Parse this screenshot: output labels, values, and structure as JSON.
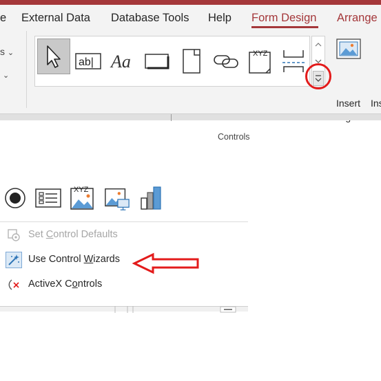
{
  "tabs": {
    "partial": "e",
    "external_data": "External Data",
    "database_tools": "Database Tools",
    "help": "Help",
    "form_design": "Form Design",
    "arrange": "Arrange"
  },
  "ribbon": {
    "left_text_1": "s",
    "left_chevron": "⌄",
    "group_label": "Controls",
    "gallery": [
      {
        "name": "select-tool-icon"
      },
      {
        "name": "text-box-icon",
        "text": "ab|"
      },
      {
        "name": "label-icon",
        "text": "Aa"
      },
      {
        "name": "button-icon"
      },
      {
        "name": "tab-control-icon"
      },
      {
        "name": "hyperlink-icon"
      },
      {
        "name": "web-browser-icon",
        "text": "XYZ"
      },
      {
        "name": "navigation-control-icon"
      }
    ],
    "insert_image": {
      "line1": "Insert",
      "line2": "Image",
      "cut": "Ins"
    }
  },
  "dropdown": {
    "icons": [
      {
        "name": "option-button-icon"
      },
      {
        "name": "list-box-icon"
      },
      {
        "name": "bound-object-frame-icon",
        "text": "XYZ"
      },
      {
        "name": "image-control-icon"
      },
      {
        "name": "chart-icon"
      }
    ],
    "items": [
      {
        "label_pre": "Set ",
        "label_key": "C",
        "label_post": "ontrol Defaults",
        "disabled": true
      },
      {
        "label_pre": "Use Control ",
        "label_key": "W",
        "label_post": "izards",
        "disabled": false
      },
      {
        "label_pre": "ActiveX C",
        "label_key": "o",
        "label_post": "ntrols",
        "disabled": false
      }
    ]
  },
  "colors": {
    "accent": "#a4373a",
    "annotation": "#e31b1b"
  }
}
